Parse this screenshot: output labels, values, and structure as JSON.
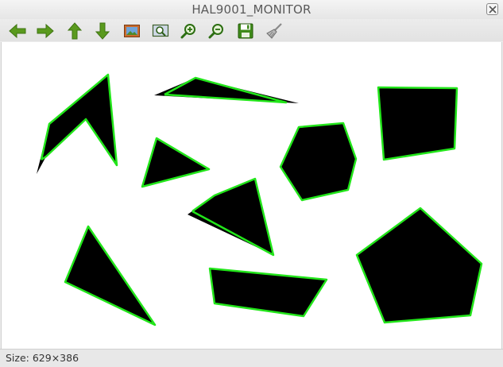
{
  "window": {
    "title": "HAL9001_MONITOR"
  },
  "toolbar": {
    "buttons": [
      {
        "icon": "arrow-left-icon",
        "tooltip": ""
      },
      {
        "icon": "arrow-right-icon",
        "tooltip": ""
      },
      {
        "icon": "arrow-up-icon",
        "tooltip": ""
      },
      {
        "icon": "arrow-down-icon",
        "tooltip": ""
      },
      {
        "icon": "image-icon",
        "tooltip": ""
      },
      {
        "icon": "zoom-fit-icon",
        "tooltip": ""
      },
      {
        "icon": "zoom-in-icon",
        "tooltip": ""
      },
      {
        "icon": "zoom-out-icon",
        "tooltip": ""
      },
      {
        "icon": "save-icon",
        "tooltip": ""
      },
      {
        "icon": "clear-brush-icon",
        "tooltip": ""
      }
    ]
  },
  "canvas": {
    "background": "#ffffff",
    "shape_fill": "#000000",
    "contour_color": "#22e51a"
  },
  "status": {
    "text": "Size: 629×386"
  }
}
